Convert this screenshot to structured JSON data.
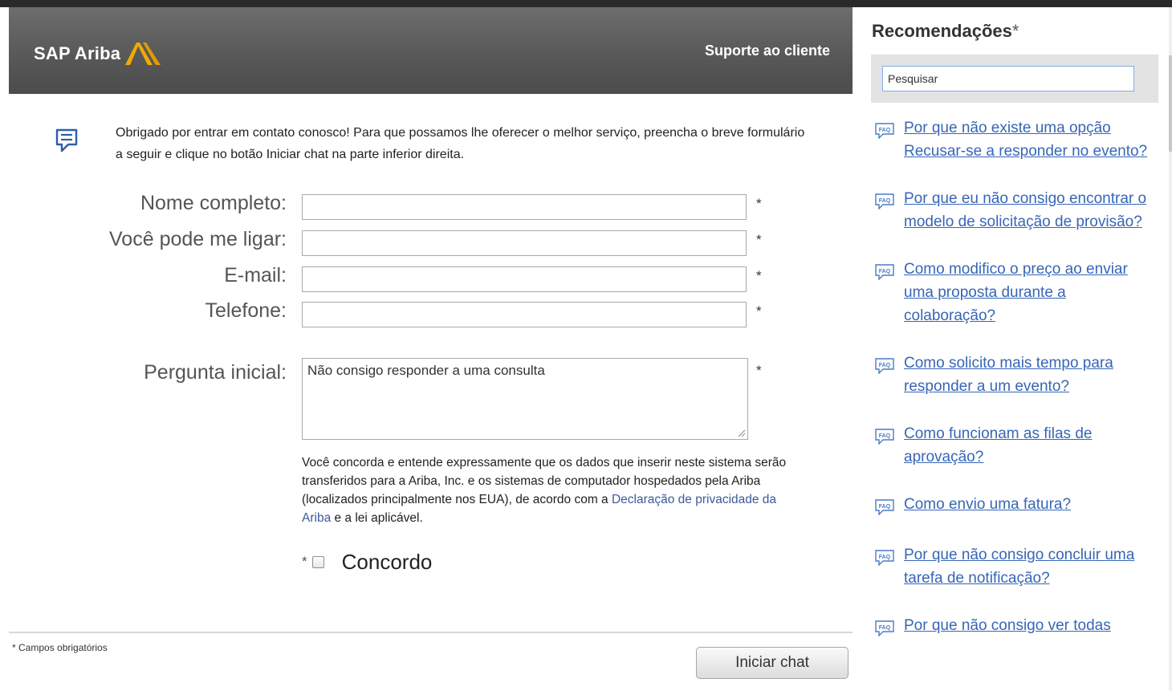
{
  "header": {
    "logo_text": "SAP Ariba",
    "support_title": "Suporte ao cliente"
  },
  "intro": {
    "icon": "chat-bubble-icon",
    "text": "Obrigado por entrar em contato conosco! Para que possamos lhe oferecer o melhor serviço, preencha o breve formulário a seguir e clique no botão Iniciar chat na parte inferior direita."
  },
  "form": {
    "fields": [
      {
        "label": "Nome completo:",
        "value": "",
        "required_mark": "*"
      },
      {
        "label": "Você pode me ligar:",
        "value": "",
        "required_mark": "*"
      },
      {
        "label": "E-mail:",
        "value": "",
        "required_mark": "*"
      },
      {
        "label": "Telefone:",
        "value": "",
        "required_mark": "*"
      }
    ],
    "question": {
      "label": "Pergunta inicial:",
      "value": "Não consigo responder a uma consulta",
      "required_mark": "*"
    },
    "consent": {
      "text_before": "Você concorda e entende expressamente que os dados que inserir neste sistema serão transferidos para a Ariba, Inc. e os sistemas de computador hospedados pela Ariba (localizados principalmente nos EUA), de acordo com a ",
      "link_text": "Declaração de privacidade da Ariba",
      "text_after": " e a lei aplicável."
    },
    "agree": {
      "required_mark": "*",
      "label": "Concordo",
      "checked": false
    }
  },
  "footer": {
    "required_note": "* Campos obrigatórios",
    "start_button": "Iniciar chat"
  },
  "recommendations": {
    "title": "Recomendações",
    "title_mark": "*",
    "search_value": "Pesquisar",
    "items": [
      {
        "icon": "faq-icon",
        "text": "Por que não existe uma opção Recusar-se a responder no evento?"
      },
      {
        "icon": "faq-icon",
        "text": "Por que eu não consigo encontrar o modelo de solicitação de provisão?"
      },
      {
        "icon": "faq-icon",
        "text": "Como modifico o preço ao enviar uma proposta durante a colaboração?"
      },
      {
        "icon": "faq-icon",
        "text": "Como solicito mais tempo para responder a um evento?"
      },
      {
        "icon": "faq-icon",
        "text": "Como funcionam as filas de aprovação?"
      },
      {
        "icon": "faq-icon",
        "text": "Como envio uma fatura?"
      },
      {
        "icon": "faq-icon",
        "text": "Por que não consigo concluir uma tarefa de notificação?"
      },
      {
        "icon": "faq-icon",
        "text": "Por que não consigo ver todas"
      }
    ]
  },
  "colors": {
    "header_bg": "#575757",
    "logo_accent": "#f0ab00",
    "link": "#3766b6",
    "search_border": "#7fb0e8"
  }
}
